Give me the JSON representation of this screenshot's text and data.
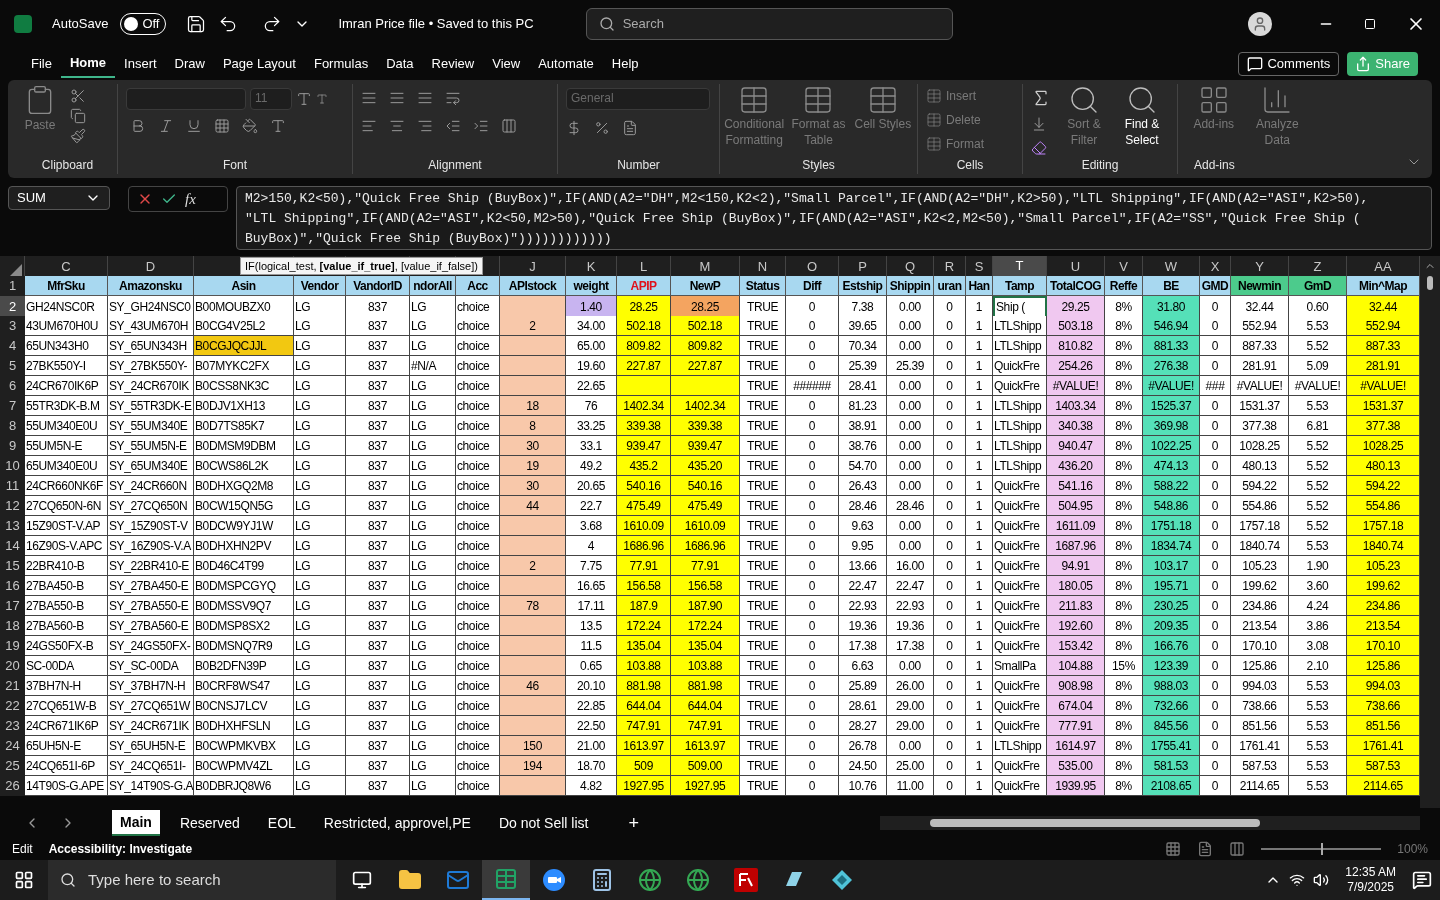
{
  "title_bar": {
    "autosave_label": "AutoSave",
    "autosave_on": false,
    "autosave_state": "Off",
    "file_title": "Imran Price file • Saved to this PC",
    "search_placeholder": "Search"
  },
  "menu_tabs": [
    {
      "label": "File",
      "selected": false
    },
    {
      "label": "Home",
      "selected": true
    },
    {
      "label": "Insert",
      "selected": false
    },
    {
      "label": "Draw",
      "selected": false
    },
    {
      "label": "Page Layout",
      "selected": false
    },
    {
      "label": "Formulas",
      "selected": false
    },
    {
      "label": "Data",
      "selected": false
    },
    {
      "label": "Review",
      "selected": false
    },
    {
      "label": "View",
      "selected": false
    },
    {
      "label": "Automate",
      "selected": false
    },
    {
      "label": "Help",
      "selected": false
    }
  ],
  "header_buttons": {
    "comments": "Comments",
    "share": "Share"
  },
  "ribbon": {
    "clipboard": {
      "label": "Clipboard",
      "paste": "Paste"
    },
    "font": {
      "label": "Font",
      "size": "11"
    },
    "alignment": {
      "label": "Alignment"
    },
    "number": {
      "label": "Number",
      "format": "General"
    },
    "styles": {
      "label": "Styles",
      "buttons": [
        {
          "label": "Conditional Formatting",
          "disabled": true
        },
        {
          "label": "Format as Table",
          "disabled": true
        },
        {
          "label": "Cell Styles",
          "disabled": true
        }
      ]
    },
    "cells": {
      "label": "Cells",
      "buttons": [
        {
          "label": "Insert",
          "disabled": true
        },
        {
          "label": "Delete",
          "disabled": true
        },
        {
          "label": "Format",
          "disabled": true
        }
      ]
    },
    "editing": {
      "label": "Editing",
      "buttons": [
        {
          "label": "Sort & Filter",
          "disabled": true
        },
        {
          "label": "Find & Select",
          "disabled": false
        }
      ]
    },
    "addins": {
      "label": "Add-ins",
      "buttons": [
        {
          "label": "Add-ins",
          "disabled": true
        },
        {
          "label": "Analyze Data",
          "disabled": true
        }
      ]
    }
  },
  "formula_bar": {
    "name_box": "SUM",
    "fx": "fx",
    "lines": [
      "M2>150,K2<50),\"Quick Free Ship (BuyBox)\",IF(AND(A2=\"DH\",M2<150,K2<2),\"Small Parcel\",IF(AND(A2=\"DH\",K2>50),\"LTL Shipping\",IF(AND(A2=\"ASI\",K2>50),",
      "\"LTL Shipping\",IF(AND(A2=\"ASI\",K2<50,M2>50),\"Quick Free Ship (BuyBox)\",IF(AND(A2=\"ASI\",K2<2,M2<50),\"Small Parcel\",IF(A2=\"SS\",\"Quick Free Ship (",
      "BuyBox)\",\"Quick Free Ship (BuyBox)\"))))))))))))"
    ]
  },
  "tooltip": "IF(logical_test, **[value_if_true]**, [value_if_false])",
  "grid": {
    "columns": [
      {
        "letter": "C",
        "header": "MfrSku",
        "kind": "standard",
        "selected": false
      },
      {
        "letter": "D",
        "header": "Amazonsku",
        "kind": "standard",
        "selected": false
      },
      {
        "header": "Asin",
        "kind": "standard",
        "selected": false
      },
      {
        "header": "Vendor",
        "kind": "standard",
        "selected": false
      },
      {
        "header": "VandorID",
        "kind": "standard",
        "selected": false
      },
      {
        "header": "ndorAll",
        "kind": "standard",
        "selected": false
      },
      {
        "header": "Acc",
        "kind": "standard",
        "selected": false
      },
      {
        "letter": "J",
        "header": "APIstock",
        "kind": "standard",
        "selected": false,
        "color": "#f8c8aa"
      },
      {
        "letter": "K",
        "header": "weight",
        "kind": "standard",
        "selected": false
      },
      {
        "letter": "L",
        "header": "APIP",
        "kind": "alert",
        "selected": false,
        "color": "#ffff00"
      },
      {
        "letter": "M",
        "header": "NewP",
        "kind": "standard",
        "selected": false,
        "color": "#ffff00"
      },
      {
        "letter": "N",
        "header": "Status",
        "kind": "standard",
        "selected": false
      },
      {
        "letter": "O",
        "header": "Diff",
        "kind": "standard",
        "selected": false
      },
      {
        "letter": "P",
        "header": "Estship",
        "kind": "standard",
        "selected": false
      },
      {
        "letter": "Q",
        "header": "Shippin",
        "kind": "standard",
        "selected": false
      },
      {
        "letter": "R",
        "header": "uran",
        "kind": "standard",
        "selected": false
      },
      {
        "letter": "S",
        "header": "Han",
        "kind": "standard",
        "selected": false
      },
      {
        "letter": "T",
        "header": "Tamp",
        "kind": "standard",
        "selected": true
      },
      {
        "letter": "U",
        "header": "TotalCOG",
        "kind": "standard",
        "selected": false,
        "color": "#f0c8f0"
      },
      {
        "letter": "V",
        "header": "Reffe",
        "kind": "standard",
        "selected": false
      },
      {
        "letter": "W",
        "header": "BE",
        "kind": "standard",
        "selected": false,
        "color": "#55e0b8"
      },
      {
        "letter": "X",
        "header": "GMD",
        "kind": "standard",
        "selected": false
      },
      {
        "letter": "Y",
        "header": "Newmin",
        "kind": "green",
        "selected": false
      },
      {
        "letter": "Z",
        "header": "GmD",
        "kind": "green",
        "selected": false
      },
      {
        "letter": "AA",
        "header": "Min^Map",
        "kind": "standard",
        "selected": false,
        "color": "#ffff00"
      }
    ],
    "header_row": "1",
    "rows": [
      {
        "num": "2",
        "selected": true,
        "cells": [
          "GH24NSC0R",
          "SY_GH24NSC0",
          "B00MOUBZX0",
          "LG",
          "837",
          "LG",
          "choice",
          null,
          {
            "text": "1.40",
            "color": "#c8b4f0"
          },
          "28.25",
          {
            "text": "28.25",
            "color": "#f4a460"
          },
          "TRUE",
          "0",
          "7.38",
          "0.00",
          "0",
          "1",
          {
            "text": "Ship (",
            "active": true
          },
          "29.25",
          "8%",
          "31.80",
          "0",
          "32.44",
          "0.60",
          "32.44"
        ]
      },
      {
        "num": "3",
        "selected": false,
        "cells": [
          "43UM670H0U",
          "SY_43UM670H",
          "B0CG4V25L2",
          "LG",
          "837",
          "LG",
          "choice",
          "2",
          "34.00",
          "502.18",
          "502.18",
          "TRUE",
          "0",
          "39.65",
          "0.00",
          "0",
          "1",
          "LTLShipp",
          "503.18",
          "8%",
          "546.94",
          "0",
          "552.94",
          "5.53",
          "552.94"
        ]
      },
      {
        "num": "4",
        "selected": false,
        "cells": [
          "65UN343H0",
          "SY_65UN343H",
          {
            "text": "B0CGJQCJJL",
            "color": "#f2c811"
          },
          "LG",
          "837",
          "LG",
          "choice",
          null,
          "65.00",
          "809.82",
          "809.82",
          "TRUE",
          "0",
          "70.34",
          "0.00",
          "0",
          "1",
          "LTLShipp",
          "810.82",
          "8%",
          "881.33",
          "0",
          "887.33",
          "5.52",
          "887.33"
        ]
      },
      {
        "num": "5",
        "selected": false,
        "cells": [
          "27BK550Y-I",
          "SY_27BK550Y-",
          "B07MYKC2FX",
          "LG",
          "837",
          "#N/A",
          "choice",
          null,
          "19.60",
          "227.87",
          "227.87",
          "TRUE",
          "0",
          "25.39",
          "25.39",
          "0",
          "1",
          "QuickFre",
          "254.26",
          "8%",
          "276.38",
          "0",
          "281.91",
          "5.09",
          "281.91"
        ]
      },
      {
        "num": "6",
        "selected": false,
        "cells": [
          "24CR670IK6P",
          "SY_24CR670IK",
          "B0CSS8NK3C",
          "LG",
          "837",
          "LG",
          "choice",
          null,
          "22.65",
          null,
          null,
          "TRUE",
          "######",
          "28.41",
          "0.00",
          "0",
          "1",
          "QuickFre",
          "#VALUE!",
          "8%",
          "#VALUE!",
          "###",
          "#VALUE!",
          "#VALUE!",
          "#VALUE!"
        ]
      },
      {
        "num": "7",
        "selected": false,
        "cells": [
          "55TR3DK-B.M",
          "SY_55TR3DK-E",
          "B0DJV1XH13",
          "LG",
          "837",
          "LG",
          "choice",
          "18",
          "76",
          "1402.34",
          "1402.34",
          "TRUE",
          "0",
          "81.23",
          "0.00",
          "0",
          "1",
          "LTLShipp",
          "1403.34",
          "8%",
          "1525.37",
          "0",
          "1531.37",
          "5.53",
          "1531.37"
        ]
      },
      {
        "num": "8",
        "selected": false,
        "cells": [
          "55UM340E0U",
          "SY_55UM340E",
          "B0D7TS85K7",
          "LG",
          "837",
          "LG",
          "choice",
          "8",
          "33.25",
          "339.38",
          "339.38",
          "TRUE",
          "0",
          "38.91",
          "0.00",
          "0",
          "1",
          "LTLShipp",
          "340.38",
          "8%",
          "369.98",
          "0",
          "377.38",
          "6.81",
          "377.38"
        ]
      },
      {
        "num": "9",
        "selected": false,
        "cells": [
          "55UM5N-E",
          "SY_55UM5N-E",
          "B0DMSM9DBM",
          "LG",
          "837",
          "LG",
          "choice",
          "30",
          "33.1",
          "939.47",
          "939.47",
          "TRUE",
          "0",
          "38.76",
          "0.00",
          "0",
          "1",
          "LTLShipp",
          "940.47",
          "8%",
          "1022.25",
          "0",
          "1028.25",
          "5.52",
          "1028.25"
        ]
      },
      {
        "num": "10",
        "selected": false,
        "cells": [
          "65UM340E0U",
          "SY_65UM340E",
          "B0CWS86L2K",
          "LG",
          "837",
          "LG",
          "choice",
          "19",
          "49.2",
          "435.2",
          "435.20",
          "TRUE",
          "0",
          "54.70",
          "0.00",
          "0",
          "1",
          "LTLShipp",
          "436.20",
          "8%",
          "474.13",
          "0",
          "480.13",
          "5.52",
          "480.13"
        ]
      },
      {
        "num": "11",
        "selected": false,
        "cells": [
          "24CR660NK6F",
          "SY_24CR660N",
          "B0DHXGQ2M8",
          "LG",
          "837",
          "LG",
          "choice",
          "30",
          "20.65",
          "540.16",
          "540.16",
          "TRUE",
          "0",
          "26.43",
          "0.00",
          "0",
          "1",
          "QuickFre",
          "541.16",
          "8%",
          "588.22",
          "0",
          "594.22",
          "5.52",
          "594.22"
        ]
      },
      {
        "num": "12",
        "selected": false,
        "cells": [
          "27CQ650N-6N",
          "SY_27CQ650N",
          "B0CW15QN5G",
          "LG",
          "837",
          "LG",
          "choice",
          "44",
          "22.7",
          "475.49",
          "475.49",
          "TRUE",
          "0",
          "28.46",
          "28.46",
          "0",
          "1",
          "QuickFre",
          "504.95",
          "8%",
          "548.86",
          "0",
          "554.86",
          "5.52",
          "554.86"
        ]
      },
      {
        "num": "13",
        "selected": false,
        "cells": [
          "15Z90ST-V.AP",
          "SY_15Z90ST-V",
          "B0DCW9YJ1W",
          "LG",
          "837",
          "LG",
          "choice",
          null,
          "3.68",
          "1610.09",
          "1610.09",
          "TRUE",
          "0",
          "9.63",
          "0.00",
          "0",
          "1",
          "QuickFre",
          "1611.09",
          "8%",
          "1751.18",
          "0",
          "1757.18",
          "5.52",
          "1757.18"
        ]
      },
      {
        "num": "14",
        "selected": false,
        "cells": [
          "16Z90S-V.APC",
          "SY_16Z90S-V.A",
          "B0DHXHN2PV",
          "LG",
          "837",
          "LG",
          "choice",
          null,
          "4",
          "1686.96",
          "1686.96",
          "TRUE",
          "0",
          "9.95",
          "0.00",
          "0",
          "1",
          "QuickFre",
          "1687.96",
          "8%",
          "1834.74",
          "0",
          "1840.74",
          "5.53",
          "1840.74"
        ]
      },
      {
        "num": "15",
        "selected": false,
        "cells": [
          "22BR410-B",
          "SY_22BR410-E",
          "B0D46C4T99",
          "LG",
          "837",
          "LG",
          "choice",
          "2",
          "7.75",
          "77.91",
          "77.91",
          "TRUE",
          "0",
          "13.66",
          "16.00",
          "0",
          "1",
          "QuickFre",
          "94.91",
          "8%",
          "103.17",
          "0",
          "105.23",
          "1.90",
          "105.23"
        ]
      },
      {
        "num": "16",
        "selected": false,
        "cells": [
          "27BA450-B",
          "SY_27BA450-E",
          "B0DMSPCGYQ",
          "LG",
          "837",
          "LG",
          "choice",
          null,
          "16.65",
          "156.58",
          "156.58",
          "TRUE",
          "0",
          "22.47",
          "22.47",
          "0",
          "1",
          "QuickFre",
          "180.05",
          "8%",
          "195.71",
          "0",
          "199.62",
          "3.60",
          "199.62"
        ]
      },
      {
        "num": "17",
        "selected": false,
        "cells": [
          "27BA550-B",
          "SY_27BA550-E",
          "B0DMSSV9Q7",
          "LG",
          "837",
          "LG",
          "choice",
          "78",
          "17.11",
          "187.9",
          "187.90",
          "TRUE",
          "0",
          "22.93",
          "22.93",
          "0",
          "1",
          "QuickFre",
          "211.83",
          "8%",
          "230.25",
          "0",
          "234.86",
          "4.24",
          "234.86"
        ]
      },
      {
        "num": "18",
        "selected": false,
        "cells": [
          "27BA560-B",
          "SY_27BA560-E",
          "B0DMSP8SX2",
          "LG",
          "837",
          "LG",
          "choice",
          null,
          "13.5",
          "172.24",
          "172.24",
          "TRUE",
          "0",
          "19.36",
          "19.36",
          "0",
          "1",
          "QuickFre",
          "192.60",
          "8%",
          "209.35",
          "0",
          "213.54",
          "3.86",
          "213.54"
        ]
      },
      {
        "num": "19",
        "selected": false,
        "cells": [
          "24GS50FX-B",
          "SY_24GS50FX-",
          "B0DMSNQ7R9",
          "LG",
          "837",
          "LG",
          "choice",
          null,
          "11.5",
          "135.04",
          "135.04",
          "TRUE",
          "0",
          "17.38",
          "17.38",
          "0",
          "1",
          "QuickFre",
          "153.42",
          "8%",
          "166.76",
          "0",
          "170.10",
          "3.08",
          "170.10"
        ]
      },
      {
        "num": "20",
        "selected": false,
        "cells": [
          "SC-00DA",
          "SY_SC-00DA",
          "B0B2DFN39P",
          "LG",
          "837",
          "LG",
          "choice",
          null,
          "0.65",
          "103.88",
          "103.88",
          "TRUE",
          "0",
          "6.63",
          "0.00",
          "0",
          "1",
          "SmallPa",
          "104.88",
          "15%",
          "123.39",
          "0",
          "125.86",
          "2.10",
          "125.86"
        ]
      },
      {
        "num": "21",
        "selected": false,
        "cells": [
          "37BH7N-H",
          "SY_37BH7N-H",
          "B0CRF8WS47",
          "LG",
          "837",
          "LG",
          "choice",
          "46",
          "20.10",
          "881.98",
          "881.98",
          "TRUE",
          "0",
          "25.89",
          "26.00",
          "0",
          "1",
          "QuickFre",
          "908.98",
          "8%",
          "988.03",
          "0",
          "994.03",
          "5.53",
          "994.03"
        ]
      },
      {
        "num": "22",
        "selected": false,
        "cells": [
          "27CQ651W-B",
          "SY_27CQ651W",
          "B0CNSJ7LCV",
          "LG",
          "837",
          "LG",
          "choice",
          null,
          "22.85",
          "644.04",
          "644.04",
          "TRUE",
          "0",
          "28.61",
          "29.00",
          "0",
          "1",
          "QuickFre",
          "674.04",
          "8%",
          "732.66",
          "0",
          "738.66",
          "5.53",
          "738.66"
        ]
      },
      {
        "num": "23",
        "selected": false,
        "cells": [
          "24CR671IK6P",
          "SY_24CR671IK",
          "B0DHXHFSLN",
          "LG",
          "837",
          "LG",
          "choice",
          null,
          "22.50",
          "747.91",
          "747.91",
          "TRUE",
          "0",
          "28.27",
          "29.00",
          "0",
          "1",
          "QuickFre",
          "777.91",
          "8%",
          "845.56",
          "0",
          "851.56",
          "5.53",
          "851.56"
        ]
      },
      {
        "num": "24",
        "selected": false,
        "cells": [
          "65UH5N-E",
          "SY_65UH5N-E",
          "B0CWPMKVBX",
          "LG",
          "837",
          "LG",
          "choice",
          "150",
          "21.00",
          "1613.97",
          "1613.97",
          "TRUE",
          "0",
          "26.78",
          "0.00",
          "0",
          "1",
          "LTLShipp",
          "1614.97",
          "8%",
          "1755.41",
          "0",
          "1761.41",
          "5.53",
          "1761.41"
        ]
      },
      {
        "num": "25",
        "selected": false,
        "cells": [
          "24CQ651I-6P",
          "SY_24CQ651I-",
          "B0CWPMV4ZL",
          "LG",
          "837",
          "LG",
          "choice",
          "194",
          "18.70",
          "509",
          "509.00",
          "TRUE",
          "0",
          "24.50",
          "25.00",
          "0",
          "1",
          "QuickFre",
          "535.00",
          "8%",
          "581.53",
          "0",
          "587.53",
          "5.53",
          "587.53"
        ]
      },
      {
        "num": "26",
        "selected": false,
        "cells": [
          "14T90S-G.APE",
          "SY_14T90S-G.A",
          "B0DBRJQ8W6",
          "LG",
          "837",
          "LG",
          "choice",
          null,
          "4.82",
          "1927.95",
          "1927.95",
          "TRUE",
          "0",
          "10.76",
          "11.00",
          "0",
          "1",
          "QuickFre",
          "1939.95",
          "8%",
          "2108.65",
          "0",
          "2114.65",
          "5.53",
          "2114.65"
        ]
      }
    ]
  },
  "sheet_tabs": [
    {
      "label": "Main",
      "selected": true
    },
    {
      "label": "Reserved",
      "selected": false
    },
    {
      "label": "EOL",
      "selected": false
    },
    {
      "label": "Restricted, approvel,PE",
      "selected": false
    },
    {
      "label": "Do not Sell list",
      "selected": false
    }
  ],
  "add_sheet": "+",
  "status_bar": {
    "mode": "Edit",
    "accessibility": "Accessibility: Investigate",
    "zoom_slider": {
      "level": 0.5
    },
    "zoom": "100%"
  },
  "taskbar": {
    "search_placeholder": "Type here to search",
    "apps": [
      {
        "kind": "taskview",
        "selected": false
      },
      {
        "kind": "folder",
        "selected": false
      },
      {
        "kind": "mail",
        "selected": false
      },
      {
        "kind": "sheet",
        "selected": true
      },
      {
        "kind": "meeting",
        "selected": false
      },
      {
        "kind": "calculator",
        "selected": false
      },
      {
        "kind": "browser",
        "selected": false
      },
      {
        "kind": "browser",
        "selected": false
      },
      {
        "kind": "ftp",
        "selected": false
      },
      {
        "kind": "glass",
        "selected": false
      },
      {
        "kind": "diamond",
        "selected": false
      }
    ],
    "time": "12:35 AM",
    "date": "7/9/2025"
  }
}
